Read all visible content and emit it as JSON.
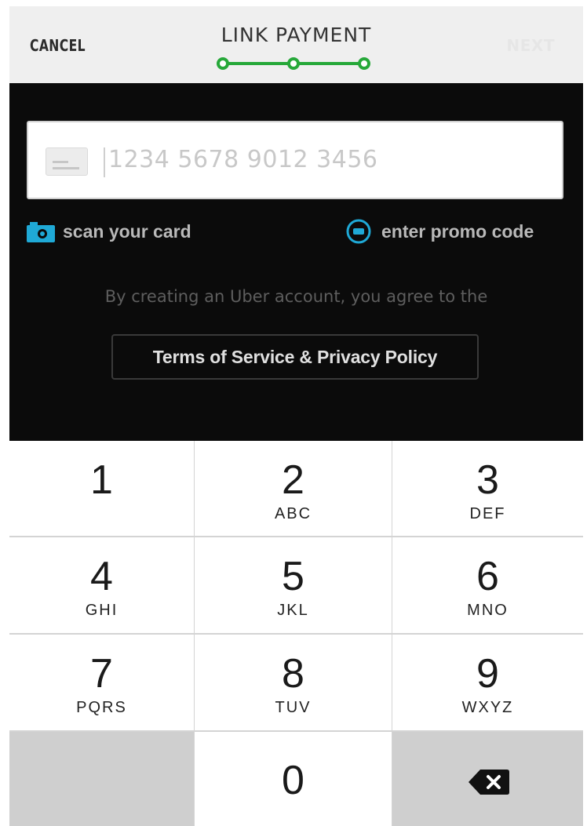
{
  "header": {
    "cancel_label": "CANCEL",
    "title": "LINK PAYMENT",
    "next_label": "NEXT",
    "progress_steps": 3,
    "accent_color": "#26a839"
  },
  "form": {
    "card_number_placeholder": "1234 5678 9012 3456",
    "card_icon": "credit-card-icon",
    "scan_label": "scan your card",
    "scan_icon": "camera-icon",
    "promo_label": "enter promo code",
    "promo_icon": "promo-icon",
    "link_color": "#1fa9d6",
    "agreement_text": "By creating an Uber account, you agree to the",
    "terms_label": "Terms of Service & Privacy Policy"
  },
  "keypad": {
    "keys": [
      {
        "digit": "1",
        "letters": ""
      },
      {
        "digit": "2",
        "letters": "ABC"
      },
      {
        "digit": "3",
        "letters": "DEF"
      },
      {
        "digit": "4",
        "letters": "GHI"
      },
      {
        "digit": "5",
        "letters": "JKL"
      },
      {
        "digit": "6",
        "letters": "MNO"
      },
      {
        "digit": "7",
        "letters": "PQRS"
      },
      {
        "digit": "8",
        "letters": "TUV"
      },
      {
        "digit": "9",
        "letters": "WXYZ"
      },
      {
        "digit": "0",
        "letters": ""
      }
    ],
    "delete_icon": "backspace-icon"
  }
}
